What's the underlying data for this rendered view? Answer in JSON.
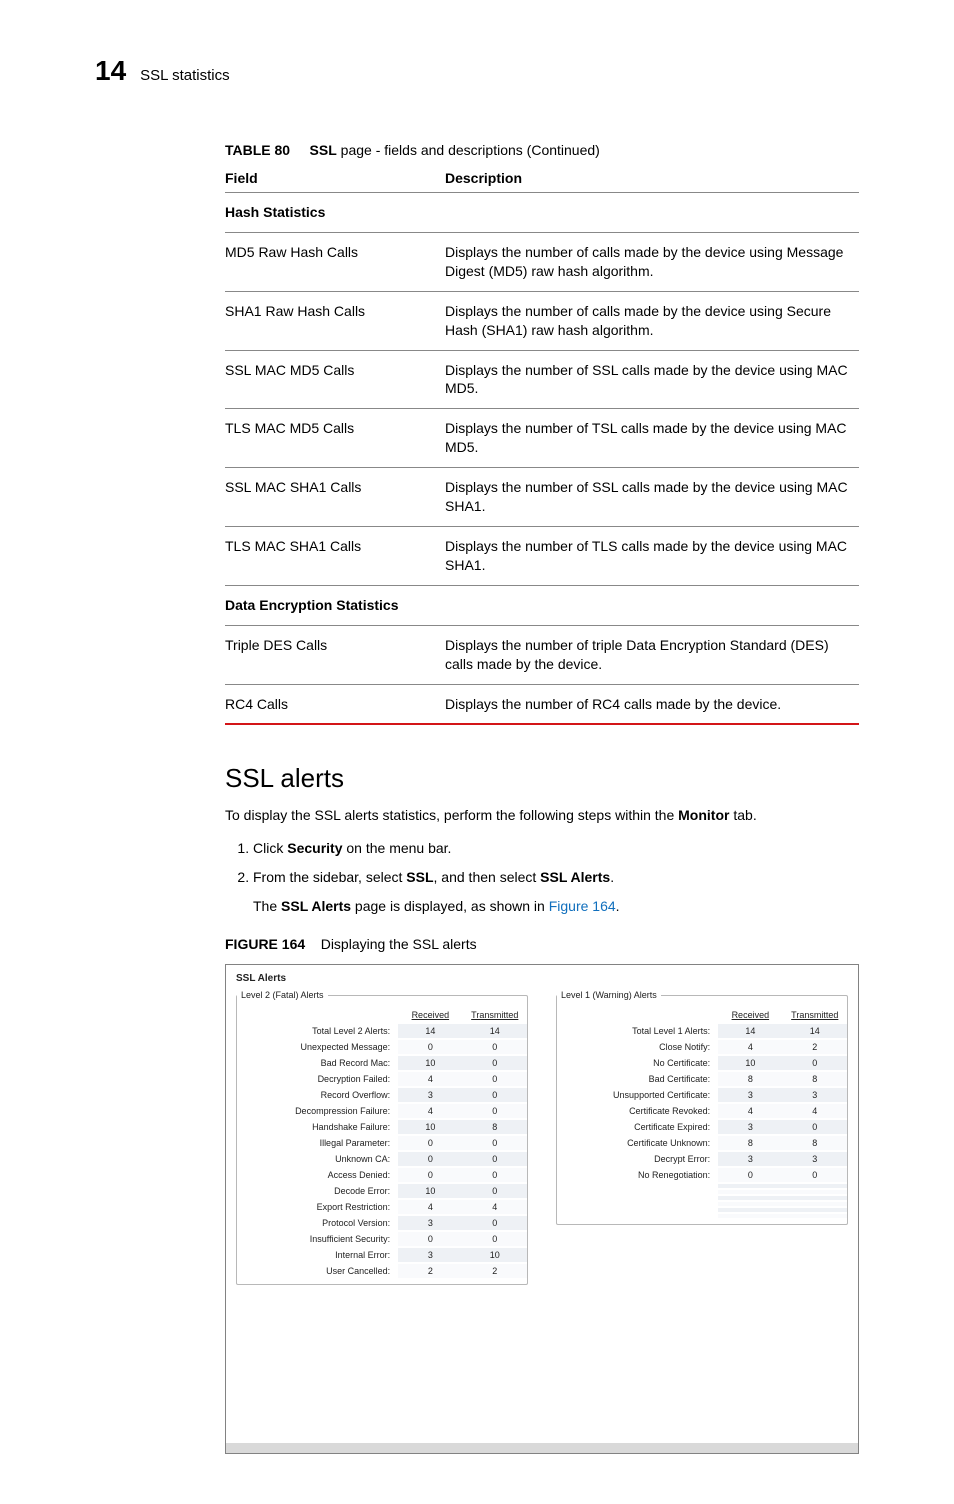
{
  "header": {
    "chapter": "14",
    "title": "SSL statistics"
  },
  "table": {
    "label": "TABLE 80",
    "caption_bold": "SSL",
    "caption_rest": " page - fields and descriptions (Continued)",
    "col_field": "Field",
    "col_desc": "Description",
    "rows": [
      {
        "section": true,
        "field": "Hash Statistics",
        "desc": ""
      },
      {
        "field": "MD5 Raw Hash Calls",
        "desc": "Displays the number of calls made by the device using Message Digest (MD5) raw hash algorithm."
      },
      {
        "field": "SHA1 Raw Hash Calls",
        "desc": "Displays the number of calls made by the device using Secure Hash (SHA1) raw hash algorithm."
      },
      {
        "field": "SSL MAC MD5 Calls",
        "desc": "Displays the number of SSL calls made by the device using MAC MD5."
      },
      {
        "field": "TLS MAC MD5 Calls",
        "desc": "Displays the number of TSL calls made by the device using MAC MD5."
      },
      {
        "field": "SSL MAC SHA1 Calls",
        "desc": "Displays the number of SSL calls made by the device using MAC SHA1."
      },
      {
        "field": "TLS MAC SHA1 Calls",
        "desc": "Displays the number of TLS calls made by the device using MAC SHA1."
      },
      {
        "section": true,
        "field": "Data Encryption Statistics",
        "desc": ""
      },
      {
        "field": "Triple DES Calls",
        "desc": "Displays the number of triple Data Encryption Standard (DES) calls made by the device."
      },
      {
        "field": "RC4 Calls",
        "desc": "Displays the number of RC4 calls made by the device."
      }
    ]
  },
  "section": {
    "title": "SSL alerts",
    "intro_pre": "To display the SSL alerts statistics, perform the following steps within the ",
    "intro_bold": "Monitor",
    "intro_post": " tab.",
    "step1_pre": "Click ",
    "step1_bold": "Security",
    "step1_post": " on the menu bar.",
    "step2_pre": "From the sidebar, select ",
    "step2_bold1": "SSL",
    "step2_mid": ", and then select ",
    "step2_bold2": "SSL Alerts",
    "step2_post": ".",
    "step2_p_pre": "The ",
    "step2_p_bold": "SSL Alerts",
    "step2_p_mid": " page is displayed, as shown in ",
    "step2_p_link": "Figure 164",
    "step2_p_post": "."
  },
  "figure": {
    "label": "FIGURE 164",
    "caption": "Displaying the SSL alerts"
  },
  "chart_data": {
    "type": "table",
    "panel_title": "SSL Alerts",
    "groups": [
      {
        "legend": "Level 2 (Fatal) Alerts",
        "columns": [
          "Received",
          "Transmitted"
        ],
        "rows": [
          {
            "label": "Total Level 2 Alerts:",
            "received": 14,
            "transmitted": 14
          },
          {
            "label": "Unexpected Message:",
            "received": 0,
            "transmitted": 0
          },
          {
            "label": "Bad Record Mac:",
            "received": 10,
            "transmitted": 0
          },
          {
            "label": "Decryption Failed:",
            "received": 4,
            "transmitted": 0
          },
          {
            "label": "Record Overflow:",
            "received": 3,
            "transmitted": 0
          },
          {
            "label": "Decompression Failure:",
            "received": 4,
            "transmitted": 0
          },
          {
            "label": "Handshake Failure:",
            "received": 10,
            "transmitted": 8
          },
          {
            "label": "Illegal Parameter:",
            "received": 0,
            "transmitted": 0
          },
          {
            "label": "Unknown CA:",
            "received": 0,
            "transmitted": 0
          },
          {
            "label": "Access Denied:",
            "received": 0,
            "transmitted": 0
          },
          {
            "label": "Decode Error:",
            "received": 10,
            "transmitted": 0
          },
          {
            "label": "Export Restriction:",
            "received": 4,
            "transmitted": 4
          },
          {
            "label": "Protocol Version:",
            "received": 3,
            "transmitted": 0
          },
          {
            "label": "Insufficient Security:",
            "received": 0,
            "transmitted": 0
          },
          {
            "label": "Internal Error:",
            "received": 3,
            "transmitted": 10
          },
          {
            "label": "User Cancelled:",
            "received": 2,
            "transmitted": 2
          }
        ]
      },
      {
        "legend": "Level 1 (Warning) Alerts",
        "columns": [
          "Received",
          "Transmitted"
        ],
        "rows": [
          {
            "label": "Total Level 1 Alerts:",
            "received": 14,
            "transmitted": 14
          },
          {
            "label": "Close Notify:",
            "received": 4,
            "transmitted": 2
          },
          {
            "label": "No Certificate:",
            "received": 10,
            "transmitted": 0
          },
          {
            "label": "Bad Certificate:",
            "received": 8,
            "transmitted": 8
          },
          {
            "label": "Unsupported Certificate:",
            "received": 3,
            "transmitted": 3
          },
          {
            "label": "Certificate Revoked:",
            "received": 4,
            "transmitted": 4
          },
          {
            "label": "Certificate Expired:",
            "received": 3,
            "transmitted": 0
          },
          {
            "label": "Certificate Unknown:",
            "received": 8,
            "transmitted": 8
          },
          {
            "label": "Decrypt Error:",
            "received": 3,
            "transmitted": 3
          },
          {
            "label": "No Renegotiation:",
            "received": 0,
            "transmitted": 0
          }
        ]
      }
    ]
  }
}
